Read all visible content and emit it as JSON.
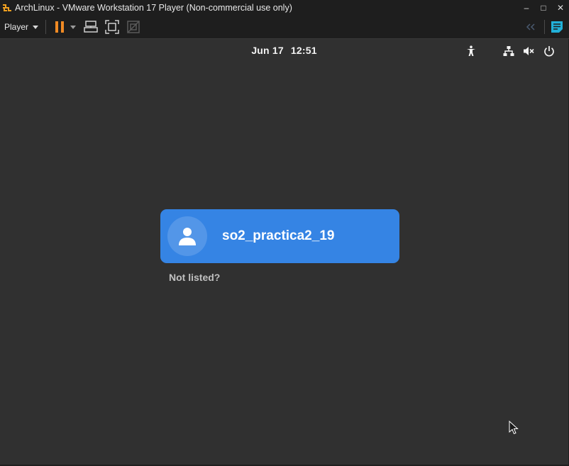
{
  "window": {
    "title": "ArchLinux - VMware Workstation 17 Player (Non-commercial use only)",
    "controls": {
      "minimize": "–",
      "maximize": "□",
      "close": "✕"
    }
  },
  "toolbar": {
    "player_label": "Player",
    "icons": [
      "pause-icon",
      "send-ctrl-alt-del-icon",
      "fullscreen-icon",
      "unity-icon",
      "collapse-icon",
      "notes-icon"
    ]
  },
  "guest": {
    "topbar": {
      "date": "Jun 17",
      "time": "12:51",
      "status_icons": [
        "accessibility-icon",
        "network-icon",
        "volume-muted-icon",
        "power-icon"
      ]
    },
    "login": {
      "username": "so2_practica2_19",
      "not_listed": "Not listed?"
    }
  },
  "colors": {
    "accent": "#3584e4",
    "guest_background": "#303030",
    "pause_orange": "#f08a24",
    "notes_cyan": "#22b0d8"
  }
}
